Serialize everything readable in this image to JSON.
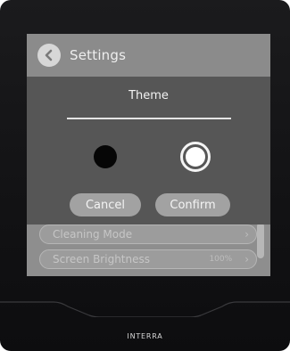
{
  "header": {
    "title": "Settings"
  },
  "background_list": {
    "items": [
      {
        "label": "Cleaning Mode",
        "value": ""
      },
      {
        "label": "Screen Brightness",
        "value": "100%"
      }
    ]
  },
  "dialog": {
    "title": "Theme",
    "options": [
      {
        "name": "dark",
        "color": "#060606",
        "selected": false
      },
      {
        "name": "light",
        "color": "#ffffff",
        "selected": true
      }
    ],
    "cancel_label": "Cancel",
    "confirm_label": "Confirm"
  },
  "brand": {
    "name": "INTERRA"
  },
  "colors": {
    "bezel": "#151517",
    "screen_dim": "#8e8e8e",
    "dialog_bg": "#565656",
    "button_bg": "#a2a2a2"
  },
  "icons": {
    "back": "chevron-left-icon",
    "chevron_right": "chevron-right-icon"
  }
}
